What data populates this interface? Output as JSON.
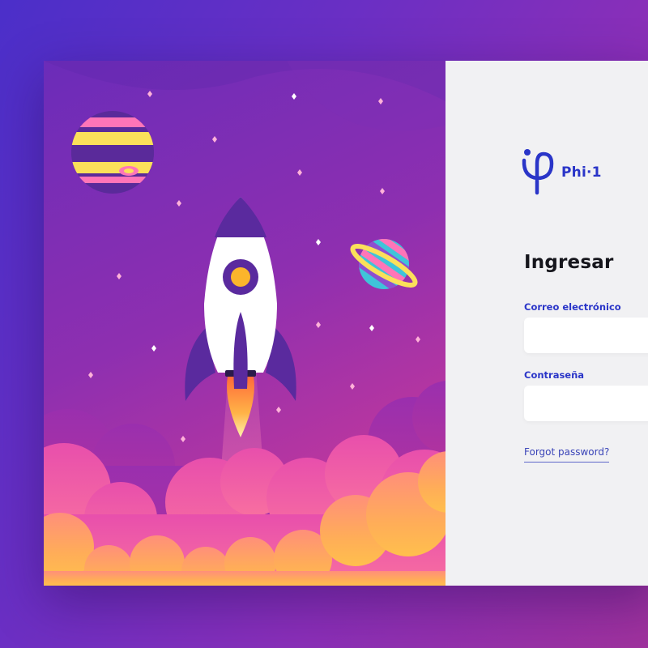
{
  "brand": {
    "name": "Phi·1",
    "primary_color": "#2a35c8",
    "logo_icon": "phi-logo-icon"
  },
  "login": {
    "title": "Ingresar",
    "email_label": "Correo electrónico",
    "email_value": "",
    "password_label": "Contraseña",
    "password_value": "",
    "forgot_password": "Forgot password?"
  },
  "illustration": {
    "theme": "rocket-launch",
    "icons": [
      "rocket-icon",
      "striped-planet-icon",
      "ringed-planet-icon",
      "star-icon",
      "cloud-icon"
    ],
    "colors": {
      "sky_top": "#6a2cb8",
      "sky_bottom": "#c2379a",
      "cloud_pink": "#f05aa7",
      "cloud_orange": "#ffb64a",
      "rocket_body": "#ffffff",
      "rocket_accent": "#5a2a9e",
      "planet_yellow": "#fbe05a"
    }
  }
}
